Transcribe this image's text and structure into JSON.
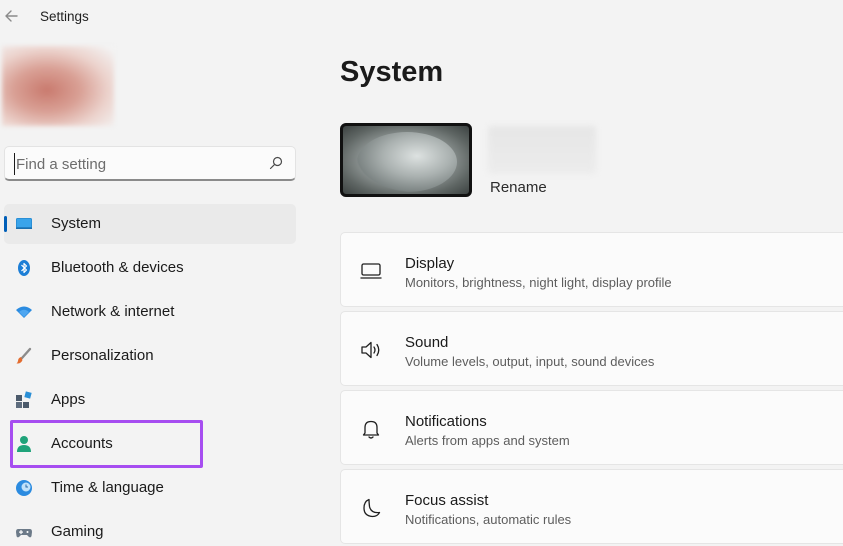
{
  "window": {
    "title": "Settings"
  },
  "search": {
    "placeholder": "Find a setting"
  },
  "sidebar": {
    "items": [
      {
        "label": "System",
        "icon": "monitor-icon",
        "selected": true
      },
      {
        "label": "Bluetooth & devices",
        "icon": "bluetooth-icon"
      },
      {
        "label": "Network & internet",
        "icon": "wifi-icon"
      },
      {
        "label": "Personalization",
        "icon": "brush-icon"
      },
      {
        "label": "Apps",
        "icon": "apps-icon"
      },
      {
        "label": "Accounts",
        "icon": "person-icon",
        "highlighted": true
      },
      {
        "label": "Time & language",
        "icon": "globe-clock-icon"
      },
      {
        "label": "Gaming",
        "icon": "gamepad-icon"
      }
    ]
  },
  "main": {
    "title": "System",
    "device": {
      "rename_label": "Rename"
    },
    "cards": [
      {
        "title": "Display",
        "subtitle": "Monitors, brightness, night light, display profile",
        "icon": "display-icon"
      },
      {
        "title": "Sound",
        "subtitle": "Volume levels, output, input, sound devices",
        "icon": "speaker-icon"
      },
      {
        "title": "Notifications",
        "subtitle": "Alerts from apps and system",
        "icon": "bell-icon"
      },
      {
        "title": "Focus assist",
        "subtitle": "Notifications, automatic rules",
        "icon": "moon-icon"
      }
    ]
  },
  "colors": {
    "accent": "#005fb8",
    "highlight_outline": "#a64df0",
    "background": "#f3f3f3",
    "card": "#fbfbfb"
  }
}
